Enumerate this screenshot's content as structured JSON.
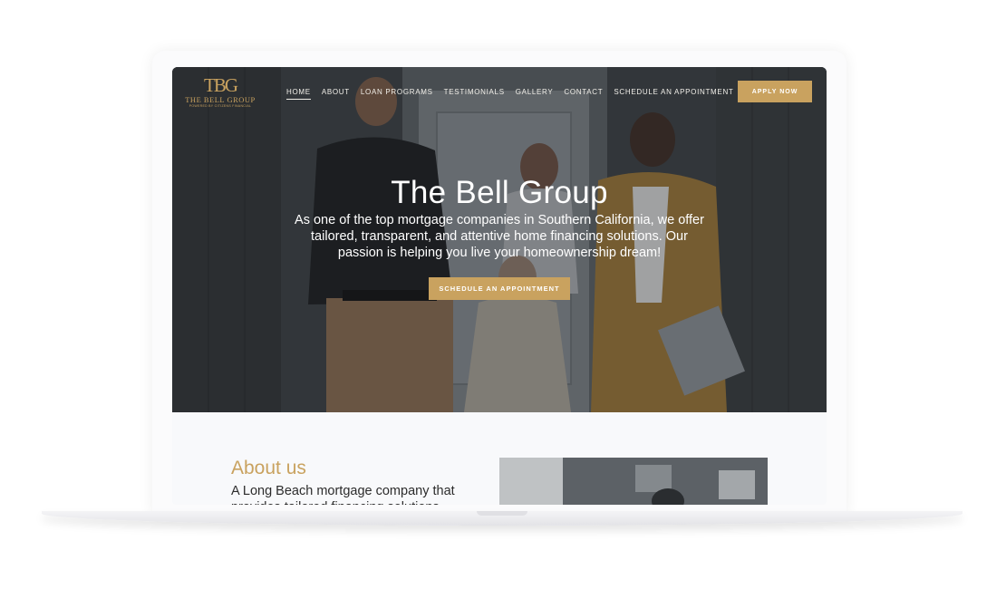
{
  "logo": {
    "monogram": "TBG",
    "name": "THE BELL GROUP",
    "tagline": "POWERED BY CITIZENS FINANCIAL"
  },
  "nav": {
    "items": [
      {
        "label": "HOME",
        "active": true
      },
      {
        "label": "ABOUT",
        "active": false
      },
      {
        "label": "LOAN PROGRAMS",
        "active": false
      },
      {
        "label": "TESTIMONIALS",
        "active": false
      },
      {
        "label": "GALLERY",
        "active": false
      },
      {
        "label": "CONTACT",
        "active": false
      },
      {
        "label": "SCHEDULE AN APPOINTMENT",
        "active": false
      }
    ],
    "apply_label": "APPLY NOW"
  },
  "hero": {
    "title": "The Bell Group",
    "text": "As one of the top mortgage companies in Southern California, we offer tailored, transparent, and attentive home financing solutions. Our passion is helping you live your homeownership dream!",
    "cta_label": "SCHEDULE AN APPOINTMENT"
  },
  "about": {
    "title": "About us",
    "text": "A Long Beach mortgage company that provides tailored financing solutions"
  },
  "colors": {
    "accent": "#c9a25f",
    "hero_overlay": "#3d4145",
    "page_background": "#f8f9fb"
  }
}
